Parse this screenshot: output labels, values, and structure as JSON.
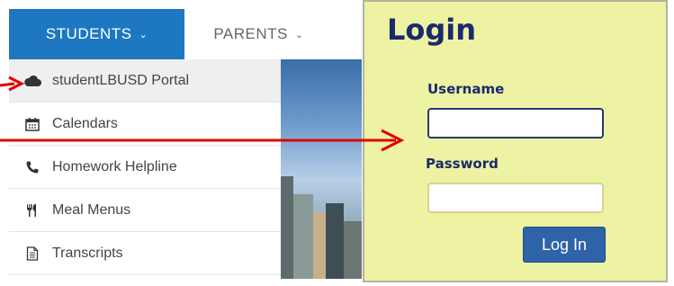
{
  "nav": {
    "tabs": [
      {
        "label": "STUDENTS",
        "chevron": "chevron-down-icon"
      },
      {
        "label": "PARENTS",
        "chevron": "chevron-down-icon"
      }
    ]
  },
  "dropdown": {
    "items": [
      {
        "label": "studentLBUSD Portal",
        "icon": "cloud-icon"
      },
      {
        "label": "Calendars",
        "icon": "calendar-icon"
      },
      {
        "label": "Homework Helpline",
        "icon": "phone-icon"
      },
      {
        "label": "Meal Menus",
        "icon": "utensils-icon"
      },
      {
        "label": "Transcripts",
        "icon": "document-icon"
      }
    ]
  },
  "login": {
    "title": "Login",
    "username_label": "Username",
    "password_label": "Password",
    "username_value": "",
    "password_value": "",
    "button_label": "Log In"
  },
  "colors": {
    "nav_active": "#1d78c1",
    "panel_bg": "#eef2a3",
    "title_color": "#1a2a6c",
    "button_bg": "#2f63a8",
    "arrow": "#e00000"
  }
}
